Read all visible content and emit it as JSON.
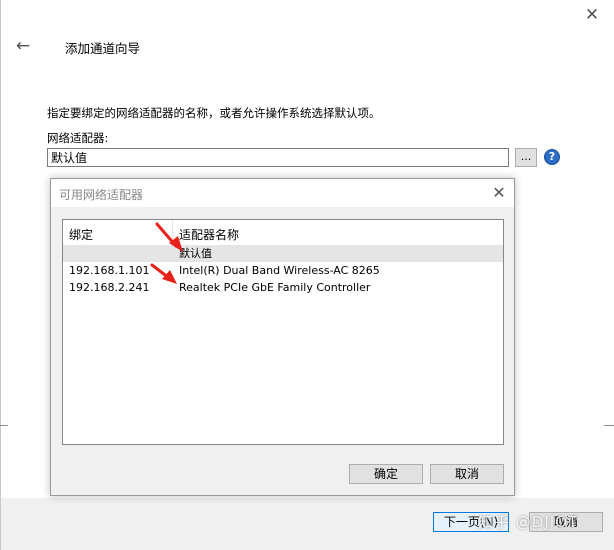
{
  "wizard": {
    "title": "添加通道向导",
    "instruction": "指定要绑定的网络适配器的名称，或者允许操作系统选择默认项。",
    "adapter_label": "网络适配器:",
    "adapter_value": "默认值",
    "browse_label": "...",
    "help_glyph": "?",
    "back_glyph": "←",
    "close_glyph": "✕",
    "next_label": "下一页(N)",
    "cancel_label": "取消"
  },
  "dialog": {
    "title": "可用网络适配器",
    "close_glyph": "✕",
    "columns": [
      "绑定",
      "适配器名称"
    ],
    "rows": [
      {
        "binding": "",
        "name": "默认值",
        "selected": true
      },
      {
        "binding": "192.168.1.101",
        "name": "Intel(R) Dual Band Wireless-AC 8265",
        "selected": false
      },
      {
        "binding": "192.168.2.241",
        "name": "Realtek PCIe GbE Family Controller",
        "selected": false
      }
    ],
    "ok_label": "确定",
    "cancel_label": "取消"
  },
  "annotations": {
    "arrow_color": "#e8201a",
    "icons": [
      "back-arrow-icon",
      "close-icon",
      "help-icon",
      "annotation-arrow"
    ]
  },
  "watermark": "知乎 @DJIOT"
}
